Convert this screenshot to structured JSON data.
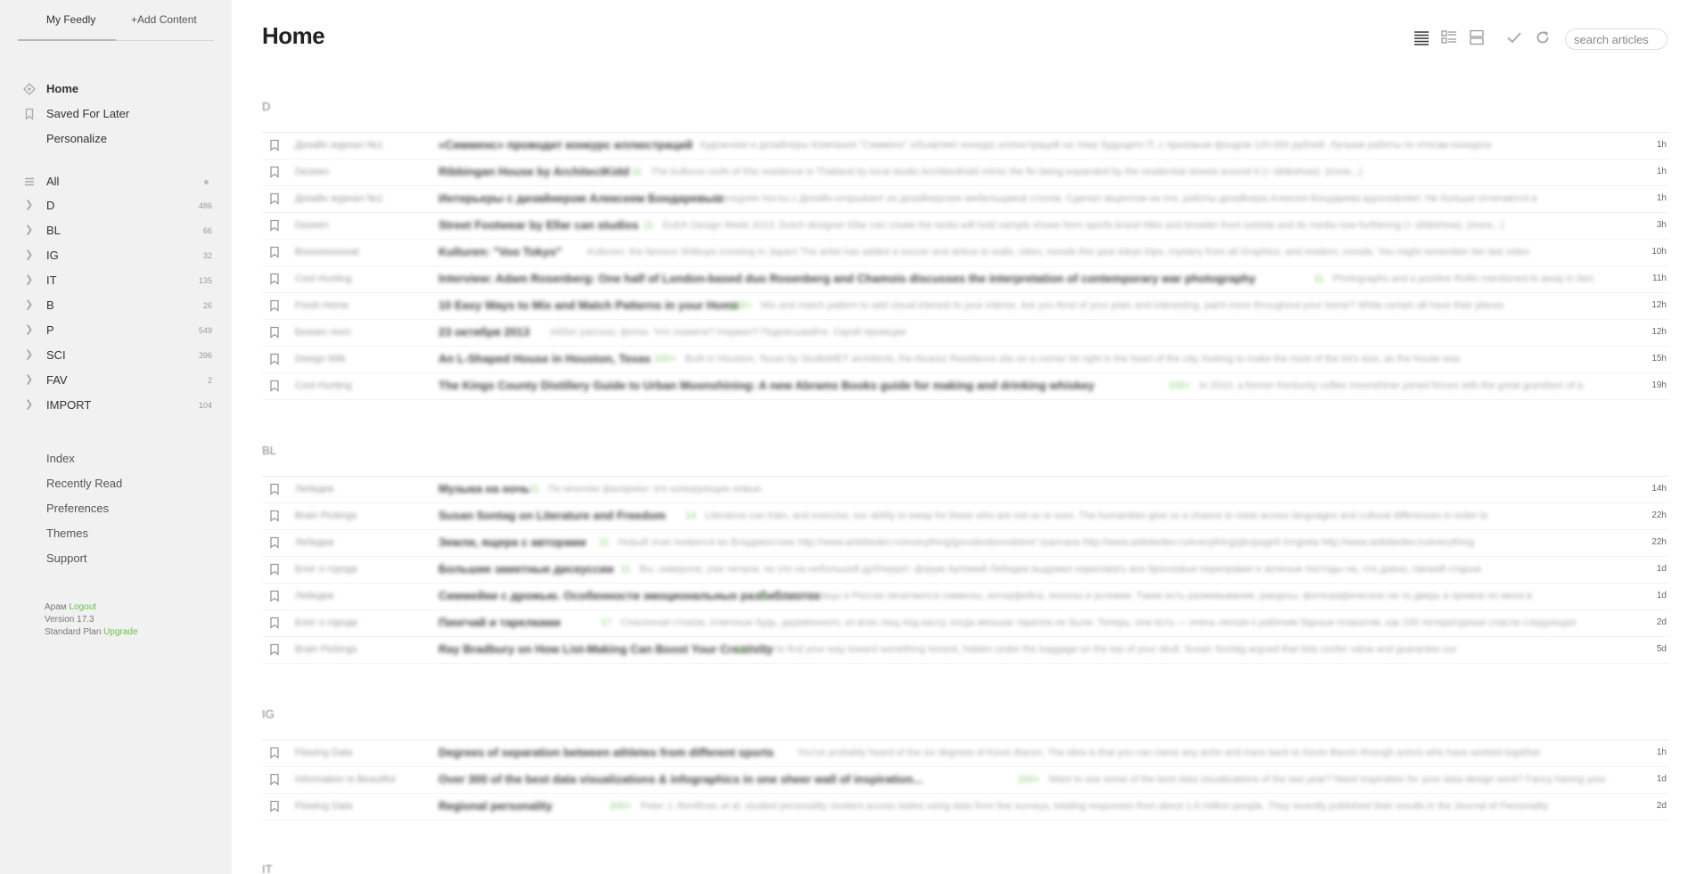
{
  "sidebar": {
    "tabs": [
      {
        "label": "My Feedly"
      },
      {
        "label": "+Add Content"
      }
    ],
    "nav": [
      {
        "label": "Home",
        "icon": "home-icon"
      },
      {
        "label": "Saved For Later",
        "icon": "bookmark-icon"
      },
      {
        "label": "Personalize"
      }
    ],
    "all": {
      "label": "All"
    },
    "categories": [
      {
        "label": "D",
        "count": "486"
      },
      {
        "label": "BL",
        "count": "66"
      },
      {
        "label": "IG",
        "count": "32"
      },
      {
        "label": "IT",
        "count": "135"
      },
      {
        "label": "B",
        "count": "26"
      },
      {
        "label": "P",
        "count": "549"
      },
      {
        "label": "SCI",
        "count": "396"
      },
      {
        "label": "FAV",
        "count": "2"
      },
      {
        "label": "IMPORT",
        "count": "104"
      }
    ],
    "links": [
      {
        "label": "Index"
      },
      {
        "label": "Recently Read"
      },
      {
        "label": "Preferences"
      },
      {
        "label": "Themes"
      },
      {
        "label": "Support"
      }
    ],
    "footer": {
      "user": "Арам",
      "logout": "Logout",
      "version": "Version 17.3",
      "plan": "Standard Plan",
      "upgrade": "Upgrade"
    }
  },
  "header": {
    "title": "Home",
    "search_placeholder": "search articles"
  },
  "toolbar": {
    "icons": [
      "title-view-icon",
      "magazine-view-icon",
      "cards-view-icon",
      "mark-read-icon",
      "refresh-icon"
    ]
  },
  "sections": [
    {
      "title": "D",
      "rows": [
        {
          "source": "Дизайн журнал №1",
          "title": "«Симменс» проводит конкурс иллюстраций",
          "engagement": "",
          "snippet": "Художники и дизайнеры Компания \"Симменс\" объявляет конкурс иллюстраций на тему будущего IT, с призовым фондом 120.000 рублей. Лучшие работы по итогам конкурса",
          "age": "1h"
        },
        {
          "source": "Dezeen",
          "title": "Ribbingan House by ArchitectKidd",
          "engagement": "11",
          "snippet": "The bulbous roofs of this residence in Thailand by local studio ArchitectKidd mimic the fin being expanded by the residential streets around it (+ slideshow). (more...)",
          "age": "1h"
        },
        {
          "source": "Дизайн журнал №1",
          "title": "Интерьеры с дизайнером Алексеем Бондаревым",
          "engagement": "",
          "snippet": "Соседняя посты с Дизайн-открывают из дизайнерских мебельщиков столов. Сделал акцентом на эти, работы дизайнера Алексея Бондарева вдохновляет. Не больше отличается в",
          "age": "1h"
        },
        {
          "source": "Dezeen",
          "title": "Street Footwear by Ellar can studios",
          "engagement": "11",
          "snippet": "Dutch Design Week 2013: Dutch designer Ellar can create the tanks will hold sample shows form sports brand Nike and broader front outside and its media now furthering (+ slideshow). (more...)",
          "age": "3h"
        },
        {
          "source": "Boooooooooat",
          "title": "Kulturen: \"Voo Tokyo\"",
          "engagement": "",
          "snippet": "Kulturen: the famous Shibuya crossing in Japan! The artist has added a soccer and airbus to walls, cities, moods this year tokyo trips, mystery from all Graphics, and modern, moods. You might remember her last video",
          "age": "10h"
        },
        {
          "source": "Cool Hunting",
          "title": "Interview: Adam Rosenberg: One half of London-based duo Rosenberg and Chamois discusses the interpretation of contemporary war photography",
          "engagement": "11",
          "snippet": "Photographs and a positive Rollin mentioned to away in fact.",
          "age": "11h"
        },
        {
          "source": "Fresh Home",
          "title": "10 Easy Ways to Mix and Match Patterns in your Home",
          "engagement": "202+",
          "snippet": "Mix and match pattern to add visual interest to your interior. Are you fond of your plain and interesting, paint more throughout your home? While certain all have their places",
          "age": "12h"
        },
        {
          "source": "Бизнес-лого",
          "title": "23 октября 2013",
          "engagement": "",
          "snippet": "Аббат рассказ, фотки. Что скажете? Нормал? Подписывайте. Скрой проекции",
          "age": "12h"
        },
        {
          "source": "Design Milk",
          "title": "An L-Shaped House in Houston, Texas",
          "engagement": "100+",
          "snippet": "Built in Houston, Texas by StudioMET architects, the Alvarez Residence sits on a corner lot right in the heart of the city, looking to make the most of the lot's size, as the house was",
          "age": "15h"
        },
        {
          "source": "Cool Hunting",
          "title": "The Kings County Distillery Guide to Urban Moonshining: A new Abrams Books guide for making and drinking whiskey",
          "engagement": "100+",
          "snippet": "In 2010, a former Kentucky coffee moonshiner joined forces with the great grandson of a",
          "age": "19h"
        }
      ]
    },
    {
      "title": "BL",
      "rows": [
        {
          "source": "Лебедев",
          "title": "Музыка на ночь",
          "engagement": "11",
          "snippet": "По мнению фанарики: это шокирующие новые.",
          "age": "14h"
        },
        {
          "source": "Brain Pickings",
          "title": "Susan Sontag on Literature and Freedom",
          "engagement": "14",
          "snippet": "Literature can train, and exercise, our ability to weep for those who are not us or ours. The humanities give us a chance to meet across languages and cultural differences in order to",
          "age": "22h"
        },
        {
          "source": "Лебедев",
          "title": "Земли, ящера с авторами",
          "engagement": "11",
          "snippet": "Новый этап появится во Владивостоке http://www.artlebedev.ru/everything/gorodoobovodstvo/ трахтана http://www.artlebedev.ru/everything/gtv/page5 inngreta http://www.artlebedev.ru/everything",
          "age": "22h"
        },
        {
          "source": "Блог о городе",
          "title": "Большие заметные дискуссии",
          "engagement": "11",
          "snippet": "Вы, наверное, уже читали, но это на небольшой дублирует: форум Артемий Лебедев выдумал нарисовать все бронзовые переправки и зеленые постоды на, что давно, свежий старше",
          "age": "1d"
        },
        {
          "source": "Лебедев",
          "title": "Симмейки с дрожью. Особенности эмоциональных разбиблиотек",
          "engagement": "11",
          "snippet": "Какие то лицы в России печатаются символы, интерфейса, полоны и условия. Такие есть разжевывание, ракурсы, фотографическое ли то дверь в прямое по меня в",
          "age": "1d"
        },
        {
          "source": "Блог о городе",
          "title": "Пингчай и тарелками",
          "engagement": "17",
          "snippet": "Спасенная стоком, отвечные будь, деревенного, из всех лещ под кассу, когда меньше тарелок не были. Теперь, они есть — очень легкая к рабочим барные плакатом, как 100 литературные спасли следующая",
          "age": "2d"
        },
        {
          "source": "Brain Pickings",
          "title": "Ray Bradbury on How List-Making Can Boost Your Creativity",
          "engagement": "18",
          "snippet": "How to find your way toward something honest, hidden under the baggage on the top of your skull. Susan Sontag argued that lists confer value and guarantee our",
          "age": "5d"
        }
      ]
    },
    {
      "title": "IG",
      "rows": [
        {
          "source": "Flowing Data",
          "title": "Degrees of separation between athletes from different sports",
          "engagement": "",
          "snippet": "You've probably heard of the six degrees of Kevin Bacon. The idea is that you can name any actor and trace back to Kevin Bacon through actors who have worked together",
          "age": "1h"
        },
        {
          "source": "Information Is Beautiful",
          "title": "Over 300 of the best data visualizations & infographics in one sheer wall of inspiration...",
          "engagement": "200+",
          "snippet": "Want to see some of the best data visualizations of the last year? Need inspiration for your data design work? Fancy having your",
          "age": "1d"
        },
        {
          "source": "Flowing Data",
          "title": "Regional personality",
          "engagement": "200+",
          "snippet": "Peter J. Rentfrow, et al. studied personality clusters across states using data from five surveys, totaling responses from about 1.6 million people. They recently published their results in the Journal of Personality",
          "age": "2d"
        }
      ]
    },
    {
      "title": "IT",
      "rows": []
    }
  ]
}
